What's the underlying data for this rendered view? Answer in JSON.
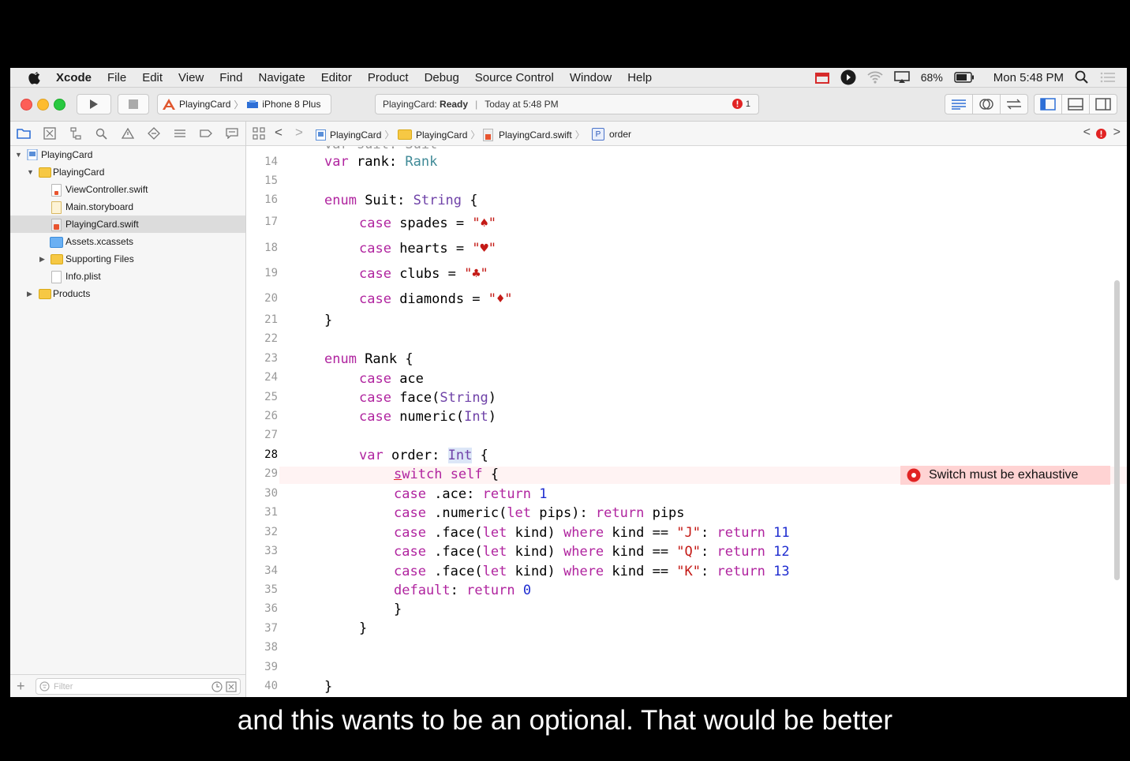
{
  "menubar": {
    "app": "Xcode",
    "items": [
      "File",
      "Edit",
      "View",
      "Find",
      "Navigate",
      "Editor",
      "Product",
      "Debug",
      "Source Control",
      "Window",
      "Help"
    ],
    "battery": "68%",
    "clock": "Mon 5:48 PM"
  },
  "toolbar": {
    "scheme_target": "PlayingCard",
    "scheme_device": "iPhone 8 Plus",
    "status_project": "PlayingCard:",
    "status_state": "Ready",
    "status_time": "Today at 5:48 PM",
    "error_count": "1"
  },
  "navigator": {
    "tree": [
      {
        "label": "PlayingCard",
        "kind": "project"
      },
      {
        "label": "PlayingCard",
        "kind": "folder"
      },
      {
        "label": "ViewController.swift",
        "kind": "swift"
      },
      {
        "label": "Main.storyboard",
        "kind": "storyboard"
      },
      {
        "label": "PlayingCard.swift",
        "kind": "swift"
      },
      {
        "label": "Assets.xcassets",
        "kind": "assets"
      },
      {
        "label": "Supporting Files",
        "kind": "folder"
      },
      {
        "label": "Info.plist",
        "kind": "plist"
      },
      {
        "label": "Products",
        "kind": "folder"
      }
    ],
    "filter_placeholder": "Filter"
  },
  "jumpbar": {
    "crumbs": [
      "PlayingCard",
      "PlayingCard",
      "PlayingCard.swift",
      "order"
    ]
  },
  "editor": {
    "partial_line": "var suit: Suit",
    "line_numbers": [
      "14",
      "15",
      "16",
      "17",
      "18",
      "19",
      "20",
      "21",
      "22",
      "23",
      "24",
      "25",
      "26",
      "27",
      "28",
      "29",
      "30",
      "31",
      "32",
      "33",
      "34",
      "35",
      "36",
      "37",
      "38",
      "39",
      "40"
    ],
    "current_line": "28",
    "error_message": "Switch must be exhaustive"
  },
  "subtitle": "and this wants to be an optional. That would be better"
}
